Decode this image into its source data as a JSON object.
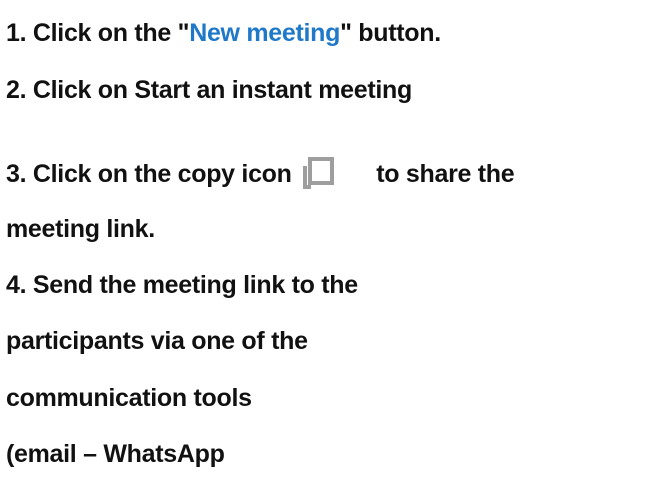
{
  "instructions": {
    "step1": {
      "prefix": "1. Click on the \"",
      "button_name": "New meeting",
      "suffix": "\" button."
    },
    "step2": {
      "text": "2. Click on Start an instant meeting"
    },
    "step3": {
      "prefix": "3. Click on the copy icon",
      "suffix": "to share the",
      "icon": "copy-icon",
      "continuation": "meeting link."
    },
    "step4": {
      "line1": "4. Send the meeting link to the",
      "line2": "participants via one of the",
      "line3": "communication tools",
      "line4": "(email – WhatsApp"
    }
  },
  "colors": {
    "text": "#111111",
    "highlight": "#1f78c8",
    "icon": "#9e9e9e"
  }
}
